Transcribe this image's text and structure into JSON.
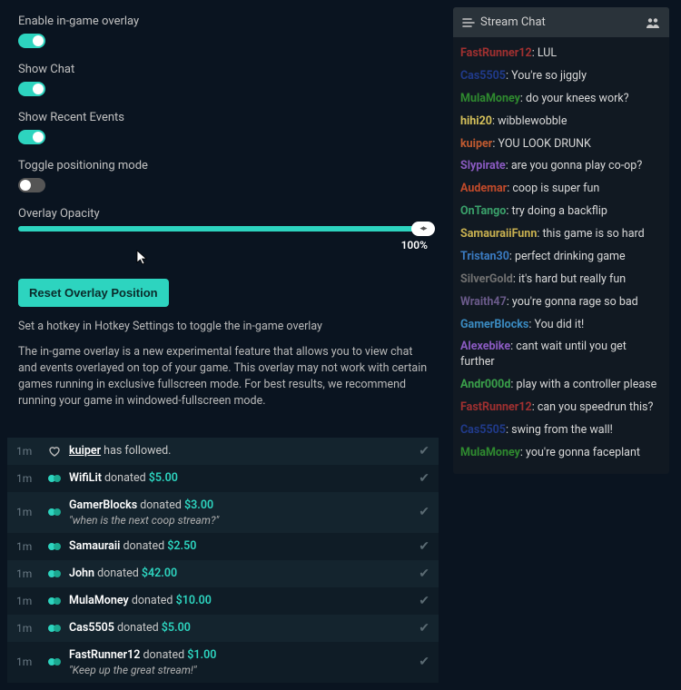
{
  "settings": {
    "overlay": {
      "label": "Enable in-game overlay",
      "on": true
    },
    "showChat": {
      "label": "Show Chat",
      "on": true
    },
    "recentEvents": {
      "label": "Show Recent Events",
      "on": true
    },
    "positioning": {
      "label": "Toggle positioning mode",
      "on": false
    },
    "opacity": {
      "label": "Overlay Opacity",
      "value": "100%"
    },
    "resetLabel": "Reset Overlay Position",
    "hotkeyNote": "Set a hotkey in Hotkey Settings to toggle the in-game overlay",
    "description": "The in-game overlay is a new experimental feature that allows you to view chat and events overlayed on top of your game. This overlay may not work with certain games running in exclusive fullscreen mode. For best results, we recommend running your game in windowed-fullscreen mode."
  },
  "events": [
    {
      "time": "1m",
      "type": "follow",
      "user": "kuiper",
      "action": "has followed."
    },
    {
      "time": "1m",
      "type": "donation",
      "user": "WifiLit",
      "action": "donated",
      "amount": "$5.00"
    },
    {
      "time": "1m",
      "type": "donation",
      "user": "GamerBlocks",
      "action": "donated",
      "amount": "$3.00",
      "message": "\"when is the next coop stream?\""
    },
    {
      "time": "1m",
      "type": "donation",
      "user": "Samauraii",
      "action": "donated",
      "amount": "$2.50"
    },
    {
      "time": "1m",
      "type": "donation",
      "user": "John",
      "action": "donated",
      "amount": "$42.00"
    },
    {
      "time": "1m",
      "type": "donation",
      "user": "MulaMoney",
      "action": "donated",
      "amount": "$10.00"
    },
    {
      "time": "1m",
      "type": "donation",
      "user": "Cas5505",
      "action": "donated",
      "amount": "$5.00"
    },
    {
      "time": "1m",
      "type": "donation",
      "user": "FastRunner12",
      "action": "donated",
      "amount": "$1.00",
      "message": "\"Keep up the great stream!\""
    }
  ],
  "chat": {
    "title": "Stream Chat",
    "messages": [
      {
        "user": "FastRunner12",
        "color": "#a03030",
        "msg": "LUL"
      },
      {
        "user": "Cas5505",
        "color": "#203a8a",
        "msg": "You're so jiggly"
      },
      {
        "user": "MulaMoney",
        "color": "#2f8a2f",
        "msg": "do your knees work?"
      },
      {
        "user": "hihi20",
        "color": "#d4c05a",
        "msg": "wibblewobble"
      },
      {
        "user": "kuiper",
        "color": "#c05a30",
        "msg": "YOU LOOK DRUNK"
      },
      {
        "user": "Slypirate",
        "color": "#8a5ac0",
        "msg": "are you gonna play co-op?"
      },
      {
        "user": "Audemar",
        "color": "#c04a2a",
        "msg": "coop is super fun"
      },
      {
        "user": "OnTango",
        "color": "#3aa06a",
        "msg": "try doing a backflip"
      },
      {
        "user": "SamauraiiFunn",
        "color": "#c8b050",
        "msg": "this game is so hard"
      },
      {
        "user": "Tristan30",
        "color": "#3a7ac0",
        "msg": "perfect drinking game"
      },
      {
        "user": "SilverGold",
        "color": "#707070",
        "msg": "it's hard but really fun"
      },
      {
        "user": "Wraith47",
        "color": "#6a5a8a",
        "msg": "you're gonna rage so bad"
      },
      {
        "user": "GamerBlocks",
        "color": "#3a8ac0",
        "msg": "You did it!"
      },
      {
        "user": "Alexebike",
        "color": "#8a5ac0",
        "msg": "cant wait until you get further"
      },
      {
        "user": "Andr000d",
        "color": "#3aa04a",
        "msg": "play with a controller please"
      },
      {
        "user": "FastRunner12",
        "color": "#a03030",
        "msg": "can you speedrun this?"
      },
      {
        "user": "Cas5505",
        "color": "#203a8a",
        "msg": "swing from the wall!"
      },
      {
        "user": "MulaMoney",
        "color": "#2f8a2f",
        "msg": "you're gonna faceplant"
      }
    ]
  }
}
